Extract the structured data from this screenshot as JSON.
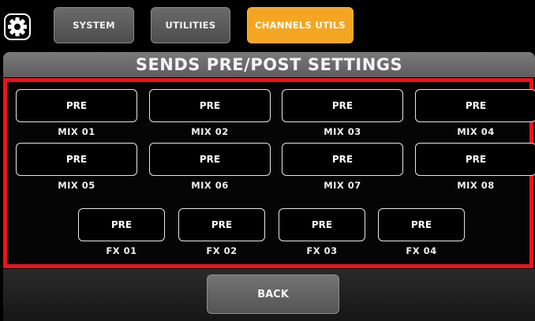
{
  "tabs": [
    {
      "label": "SYSTEM",
      "state": "inactive"
    },
    {
      "label": "UTILITIES",
      "state": "inactive"
    },
    {
      "label": "CHANNELS UTILS",
      "state": "active"
    }
  ],
  "settings_icon": "gear-icon",
  "title": "SENDS PRE/POST SETTINGS",
  "mix_sends": [
    {
      "mode": "PRE",
      "label": "MIX 01"
    },
    {
      "mode": "PRE",
      "label": "MIX 02"
    },
    {
      "mode": "PRE",
      "label": "MIX 03"
    },
    {
      "mode": "PRE",
      "label": "MIX 04"
    },
    {
      "mode": "PRE",
      "label": "MIX 05"
    },
    {
      "mode": "PRE",
      "label": "MIX 06"
    },
    {
      "mode": "PRE",
      "label": "MIX 07"
    },
    {
      "mode": "PRE",
      "label": "MIX 08"
    }
  ],
  "fx_sends": [
    {
      "mode": "PRE",
      "label": "FX 01"
    },
    {
      "mode": "PRE",
      "label": "FX 02"
    },
    {
      "mode": "PRE",
      "label": "FX 03"
    },
    {
      "mode": "PRE",
      "label": "FX 04"
    }
  ],
  "back_label": "BACK",
  "colors": {
    "active_tab": "#f4a623",
    "highlight_border": "#e8141b",
    "background": "#000000"
  }
}
